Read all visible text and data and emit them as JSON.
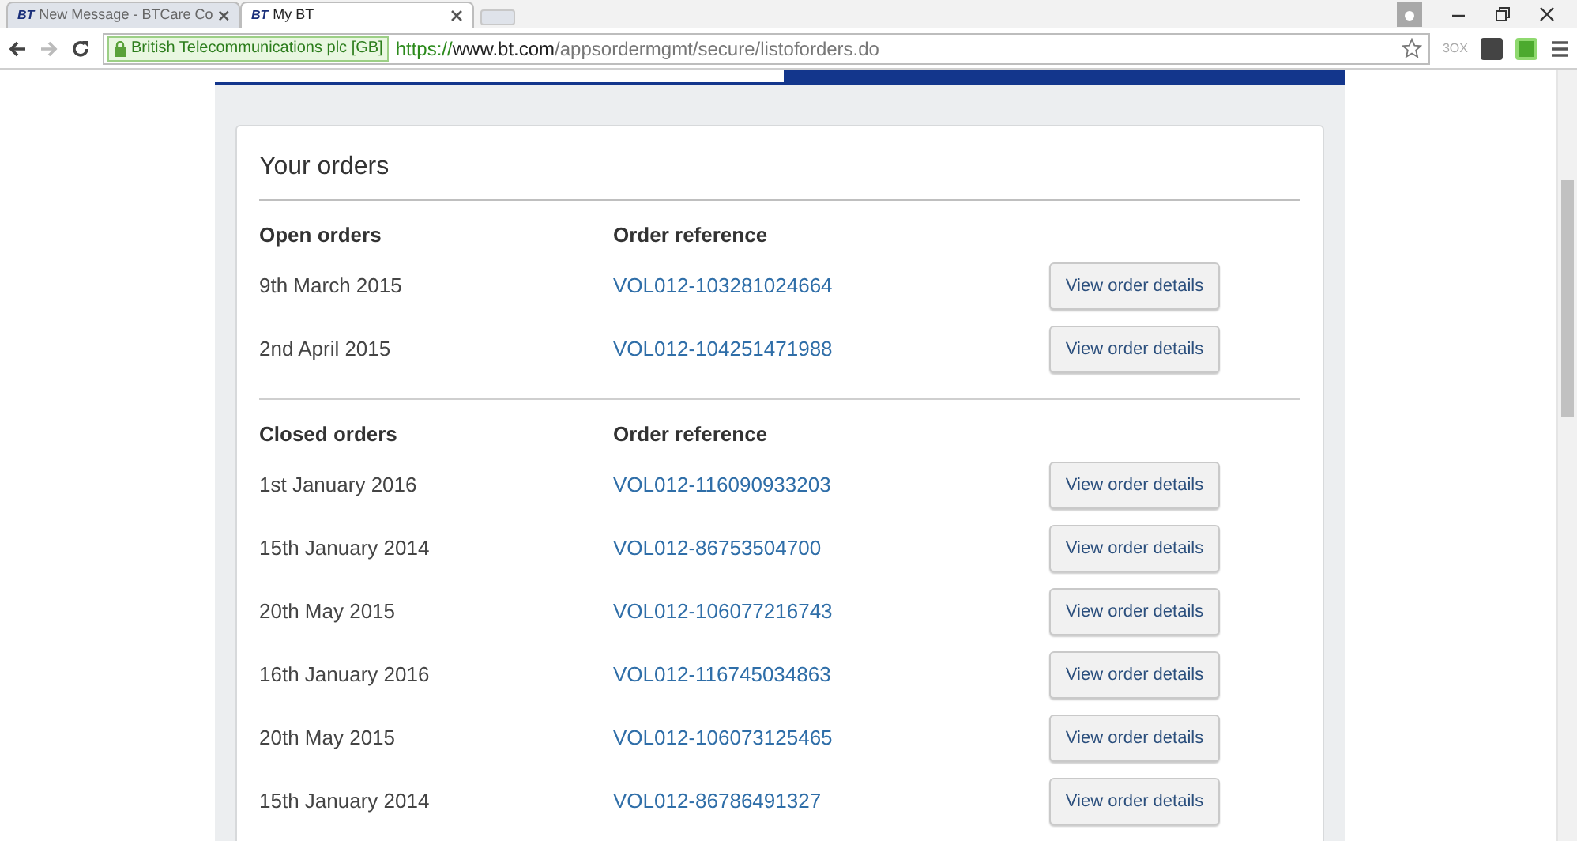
{
  "browser": {
    "tabs": [
      {
        "logo": "BT",
        "title": "New Message - BTCare Co",
        "selected": false
      },
      {
        "logo": "BT",
        "title": "My BT",
        "selected": true
      }
    ],
    "security_label": "British Telecommunications plc [GB]",
    "url": {
      "scheme": "https://",
      "host": "www.bt.com",
      "path": "/appsordermgmt/secure/listoforders.do"
    },
    "extension_label": "3OX"
  },
  "page": {
    "title": "Your orders",
    "sections": [
      {
        "heading": "Open orders",
        "ref_heading": "Order reference",
        "orders": [
          {
            "date": "9th March 2015",
            "reference": "VOL012-103281024664",
            "button": "View order details"
          },
          {
            "date": "2nd April 2015",
            "reference": "VOL012-104251471988",
            "button": "View order details"
          }
        ]
      },
      {
        "heading": "Closed orders",
        "ref_heading": "Order reference",
        "orders": [
          {
            "date": "1st January 2016",
            "reference": "VOL012-116090933203",
            "button": "View order details"
          },
          {
            "date": "15th January 2014",
            "reference": "VOL012-86753504700",
            "button": "View order details"
          },
          {
            "date": "20th May 2015",
            "reference": "VOL012-106077216743",
            "button": "View order details"
          },
          {
            "date": "16th January 2016",
            "reference": "VOL012-116745034863",
            "button": "View order details"
          },
          {
            "date": "20th May 2015",
            "reference": "VOL012-106073125465",
            "button": "View order details"
          },
          {
            "date": "15th January 2014",
            "reference": "VOL012-86786491327",
            "button": "View order details"
          }
        ]
      }
    ]
  }
}
